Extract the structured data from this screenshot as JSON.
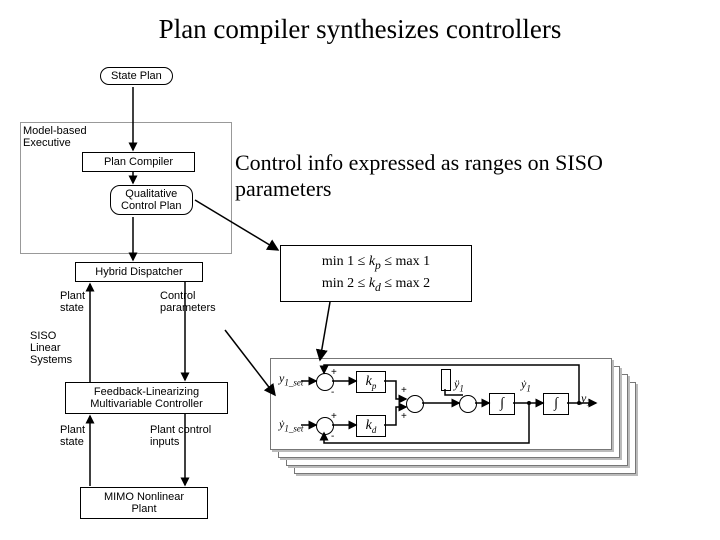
{
  "title": "Plan compiler synthesizes controllers",
  "subtitle": "Control info expressed as ranges on SISO parameters",
  "left_diagram": {
    "model_based_executive": "Model-based\nExecutive",
    "state_plan": "State Plan",
    "plan_compiler": "Plan Compiler",
    "qualitative_control_plan": "Qualitative\nControl Plan",
    "hybrid_dispatcher": "Hybrid Dispatcher",
    "plant_state_upper": "Plant\nstate",
    "control_parameters": "Control\nparameters",
    "siso_linear_systems": "SISO\nLinear\nSystems",
    "feedback_linearizing": "Feedback-Linearizing\nMultivariable Controller",
    "plant_state_lower": "Plant\nstate",
    "plant_control_inputs": "Plant control\ninputs",
    "mimo_nonlinear_plant": "MIMO Nonlinear\nPlant"
  },
  "equations": {
    "line1_left": "min 1 ≤ ",
    "line1_mid": "k",
    "line1_sub": "p",
    "line1_right": " ≤ max 1",
    "line2_left": "min 2 ≤ ",
    "line2_mid": "k",
    "line2_sub": "d",
    "line2_right": " ≤ max 2"
  },
  "schematic_labels": {
    "y1_set": "y",
    "y1_set_sub": "1_set",
    "y1_set_dot": "ẏ",
    "kp": "k",
    "kp_sub": "p",
    "kd": "k",
    "kd_sub": "d",
    "integral": "∫",
    "y1d": "ÿ",
    "y1d_sub": "1",
    "y1v": "ẏ",
    "y1v_sub": "1",
    "y1": "y",
    "y1_sub": "1",
    "plus": "+",
    "minus": "-"
  }
}
